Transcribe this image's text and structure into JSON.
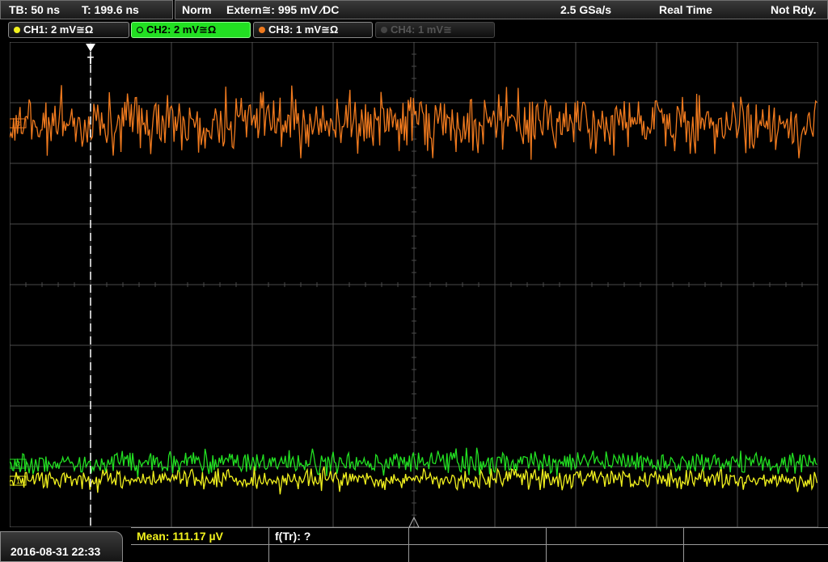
{
  "status": {
    "timebase": "TB: 50 ns",
    "trigger_time": "T: 199.6 ns",
    "mode": "Norm",
    "trigger": "Extern≅: 995 mV ∕DC",
    "sample_rate": "2.5 GSa/s",
    "acquisition": "Real Time",
    "state": "Not Rdy."
  },
  "channels": [
    {
      "label": "CH1: 2 mV≅Ω",
      "color": "#f2f21e"
    },
    {
      "label": "CH2: 2 mV≅Ω",
      "color": "#22e022"
    },
    {
      "label": "CH3: 1 mV≅Ω",
      "color": "#f07a1e"
    },
    {
      "label": "CH4: 1 mV≅",
      "color": "#5a5a5a"
    }
  ],
  "markers": {
    "trigger_marker": "T",
    "ch1_marker": "1",
    "ch2_marker": "2",
    "ch3_marker": "3"
  },
  "bottom": {
    "datetime": "2016-08-31 22:33",
    "mean_label": "Mean: 111.17 µV",
    "freq_label": "f(Tr): ?"
  },
  "colors": {
    "grid": "#4a4a4a",
    "mean_text": "#f2f21e"
  }
}
